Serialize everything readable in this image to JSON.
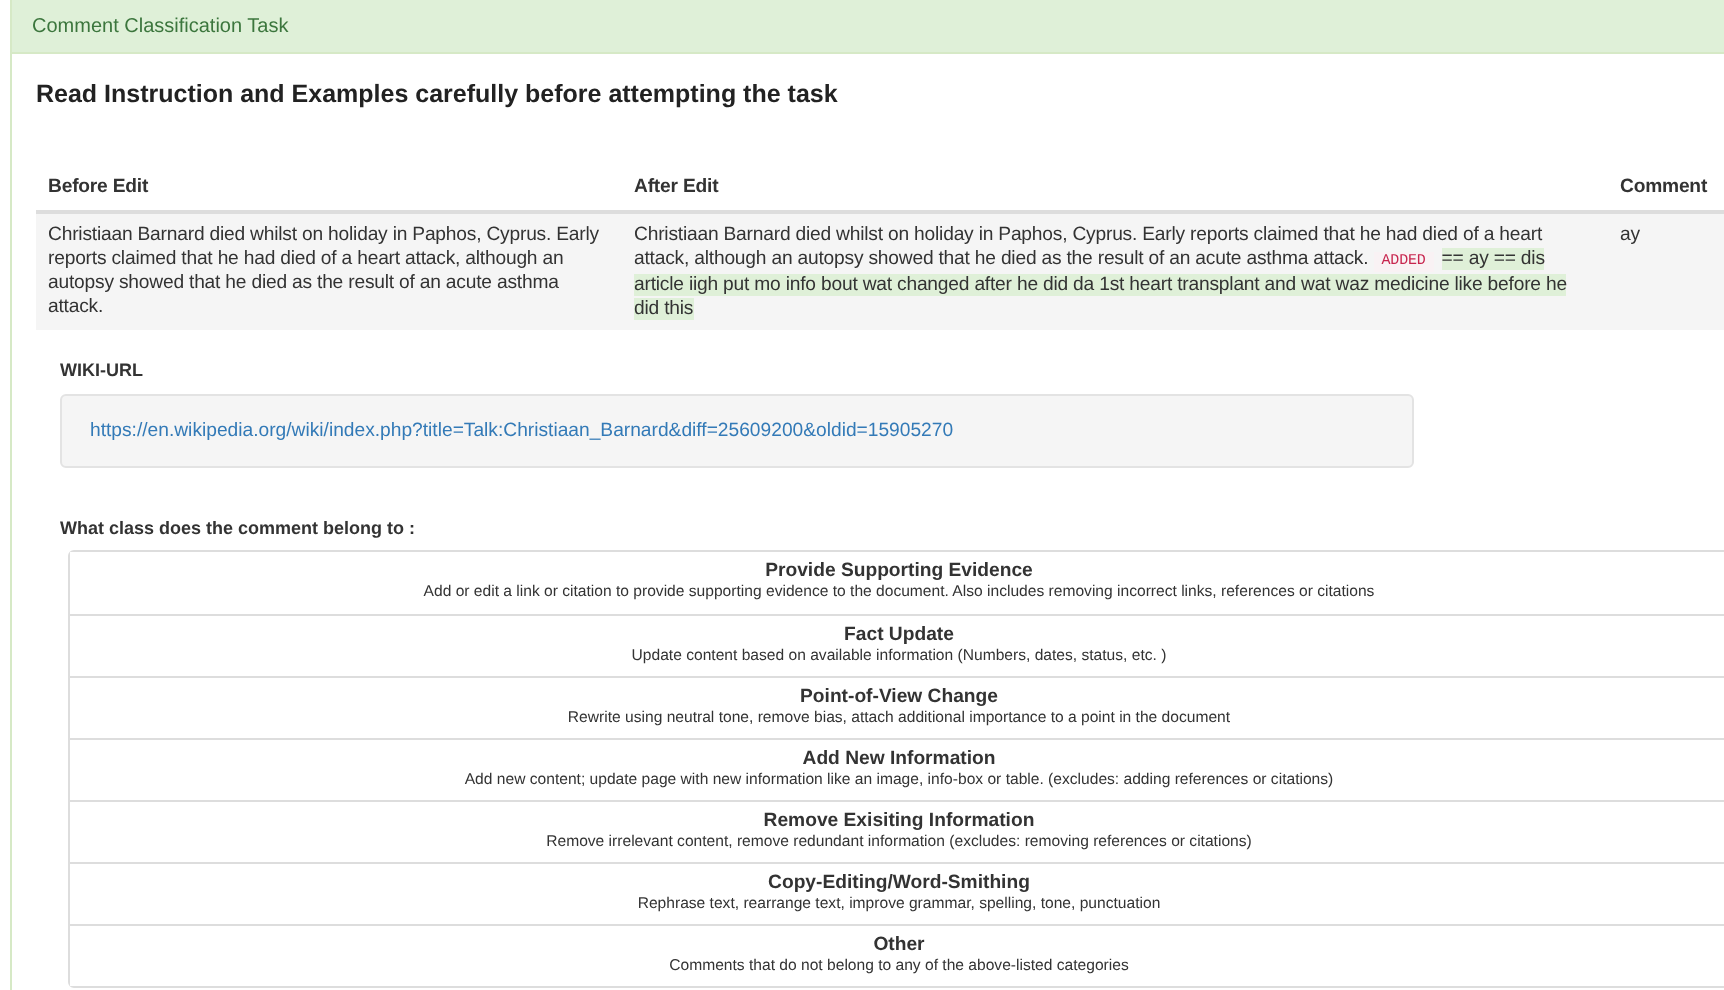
{
  "panel": {
    "title": "Comment Classification Task"
  },
  "heading": "Read Instruction and Examples carefully before attempting the task",
  "table": {
    "columns": [
      "Before Edit",
      "After Edit",
      "Comment"
    ],
    "row": {
      "before": "Christiaan Barnard died whilst on holiday in Paphos, Cyprus. Early reports claimed that he had died of a heart attack, although an autopsy showed that he died as the result of an acute asthma attack.",
      "after": "Christiaan Barnard died whilst on holiday in Paphos, Cyprus. Early reports claimed that he had died of a heart attack, although an autopsy showed that he died as the result of an acute asthma attack.",
      "added_label": "ADDED",
      "added_text": "== ay == dis article iigh put mo info bout wat changed after he did da 1st heart transplant and wat waz medicine like before he did this",
      "comment": "ay"
    }
  },
  "wiki": {
    "label": "WIKI-URL",
    "url": "https://en.wikipedia.org/wiki/index.php?title=Talk:Christiaan_Barnard&diff=25609200&oldid=15905270"
  },
  "question": "What class does the comment belong to :",
  "options": [
    {
      "title": "Provide Supporting Evidence",
      "description": "Add or edit a link or citation to provide supporting evidence to the document. Also includes removing incorrect links, references or citations"
    },
    {
      "title": "Fact Update",
      "description": "Update content based on available information (Numbers, dates, status, etc. )"
    },
    {
      "title": "Point-of-View Change",
      "description": "Rewrite using neutral tone, remove bias, attach additional importance to a point in the document"
    },
    {
      "title": "Add New Information",
      "description": "Add new content; update page with new information like an image, info-box or table. (excludes: adding references or citations)"
    },
    {
      "title": "Remove Exisiting Information",
      "description": "Remove irrelevant content, remove redundant information (excludes: removing references or citations)"
    },
    {
      "title": "Copy-Editing/Word-Smithing",
      "description": "Rephrase text, rearrange text, improve grammar, spelling, tone, punctuation"
    },
    {
      "title": "Other",
      "description": "Comments that do not belong to any of the above-listed categories"
    }
  ]
}
